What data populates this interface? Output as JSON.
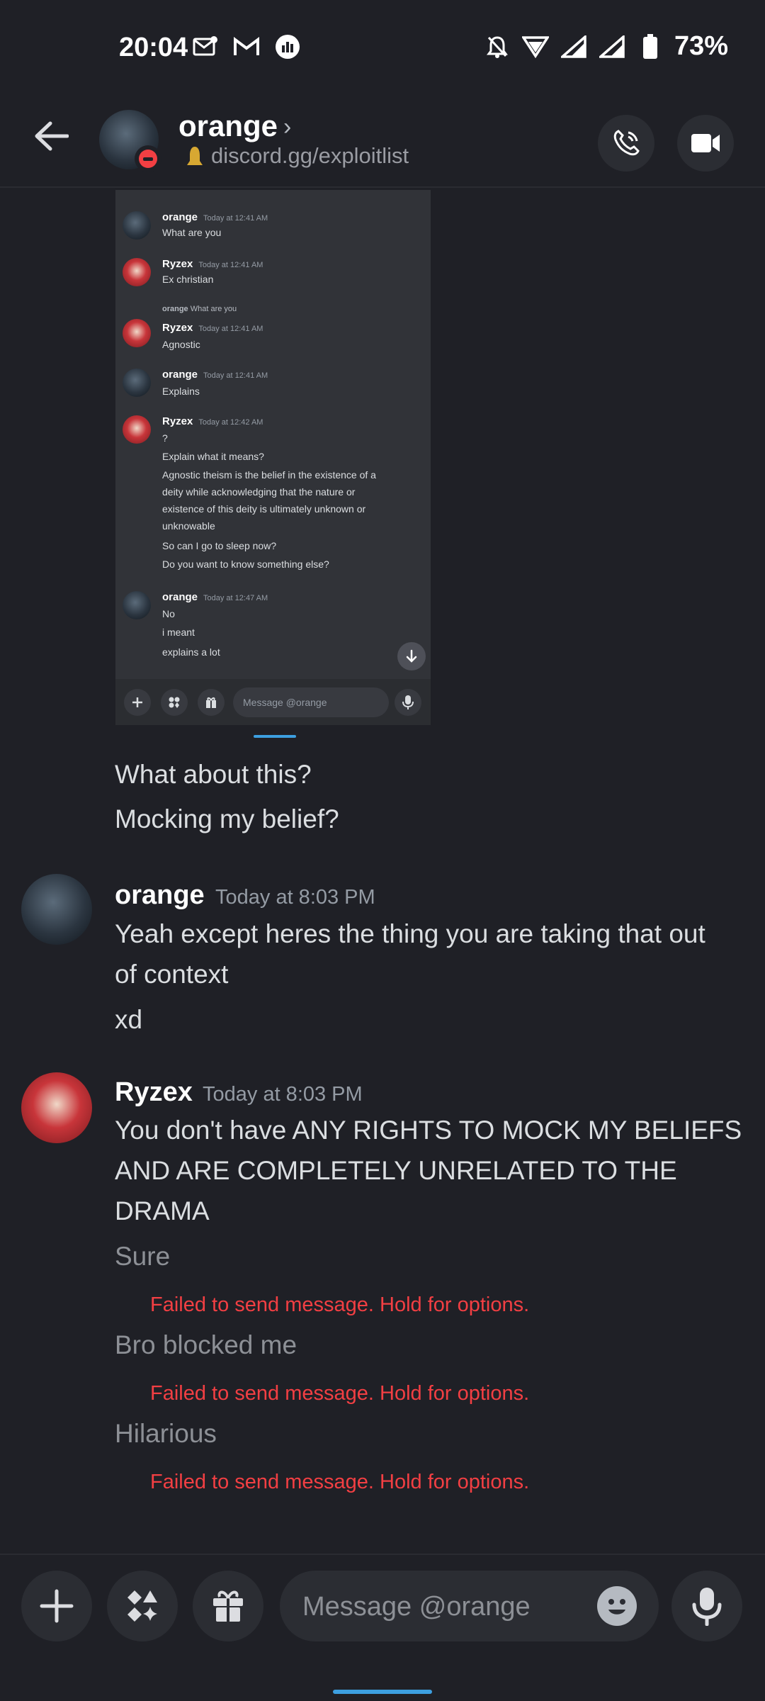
{
  "status_bar": {
    "time": "20:04",
    "battery": "73%"
  },
  "header": {
    "name": "orange",
    "status": "discord.gg/exploitlist"
  },
  "embedded": {
    "messages": [
      {
        "author": "orange",
        "time": "Today at 12:41 AM",
        "lines": [
          "What are you"
        ]
      },
      {
        "author": "Ryzex",
        "time": "Today at 12:41 AM",
        "lines": [
          "Ex christian"
        ]
      },
      {
        "reply_author": "orange",
        "reply_text": "What are you",
        "author": "Ryzex",
        "time": "Today at 12:41 AM",
        "lines": [
          "Agnostic"
        ]
      },
      {
        "author": "orange",
        "time": "Today at 12:41 AM",
        "lines": [
          "Explains"
        ]
      },
      {
        "author": "Ryzex",
        "time": "Today at 12:42 AM",
        "lines": [
          "?",
          "Explain what it means?",
          "Agnostic theism is the belief in the existence of a",
          "deity while acknowledging that the nature or",
          "existence of this deity is ultimately unknown or",
          "unknowable",
          "So can I go to sleep now?",
          "Do you want to know something else?"
        ]
      },
      {
        "author": "orange",
        "time": "Today at 12:47 AM",
        "lines": [
          "No",
          "i meant",
          "explains a lot"
        ]
      }
    ],
    "input_placeholder": "Message @orange"
  },
  "chat": {
    "continued": [
      "What about this?",
      "Mocking my belief?"
    ],
    "orange_msg": {
      "author": "orange",
      "time": "Today at 8:03 PM",
      "lines": [
        "Yeah except heres the thing you are taking that out",
        "of context",
        "xd"
      ]
    },
    "ryzex_msg": {
      "author": "Ryzex",
      "time": "Today at 8:03 PM",
      "lines": [
        "You don't have ANY RIGHTS TO MOCK MY BELIEFS",
        "AND ARE COMPLETELY UNRELATED TO THE",
        "DRAMA"
      ]
    },
    "failed_messages": [
      {
        "text": "Sure",
        "error": "Failed to send message. Hold for options."
      },
      {
        "text": "Bro blocked me",
        "error": "Failed to send message. Hold for options."
      },
      {
        "text": "Hilarious",
        "error": "Failed to send message. Hold for options."
      }
    ]
  },
  "composer": {
    "placeholder": "Message @orange"
  },
  "colors": {
    "background": "#1f2026",
    "error": "#f23f43",
    "accent": "#3d9fe0"
  }
}
